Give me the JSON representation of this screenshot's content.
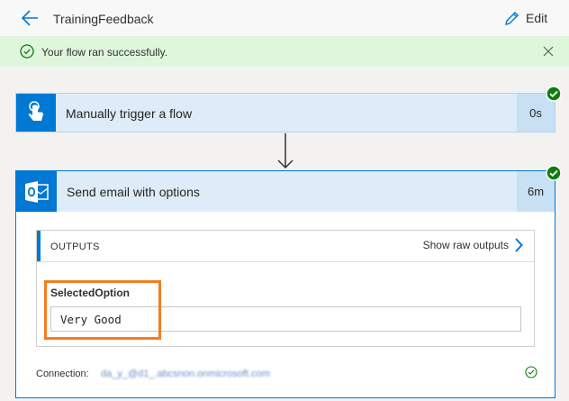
{
  "header": {
    "title": "TrainingFeedback",
    "edit_label": "Edit"
  },
  "banner": {
    "message": "Your flow ran successfully."
  },
  "trigger_step": {
    "label": "Manually trigger a flow",
    "duration": "0s",
    "status": "succeeded"
  },
  "email_step": {
    "label": "Send email with options",
    "duration": "6m",
    "status": "succeeded",
    "outputs": {
      "title": "OUTPUTS",
      "raw_label": "Show raw outputs",
      "field_name": "SelectedOption",
      "field_value": "Very Good"
    },
    "connection_label": "Connection:",
    "connection_value": "da_y_@d1_.abcsnon.onmicrosoft.com"
  },
  "colors": {
    "accent": "#0078d4",
    "success": "#107c10",
    "highlight": "#f57c1f"
  }
}
